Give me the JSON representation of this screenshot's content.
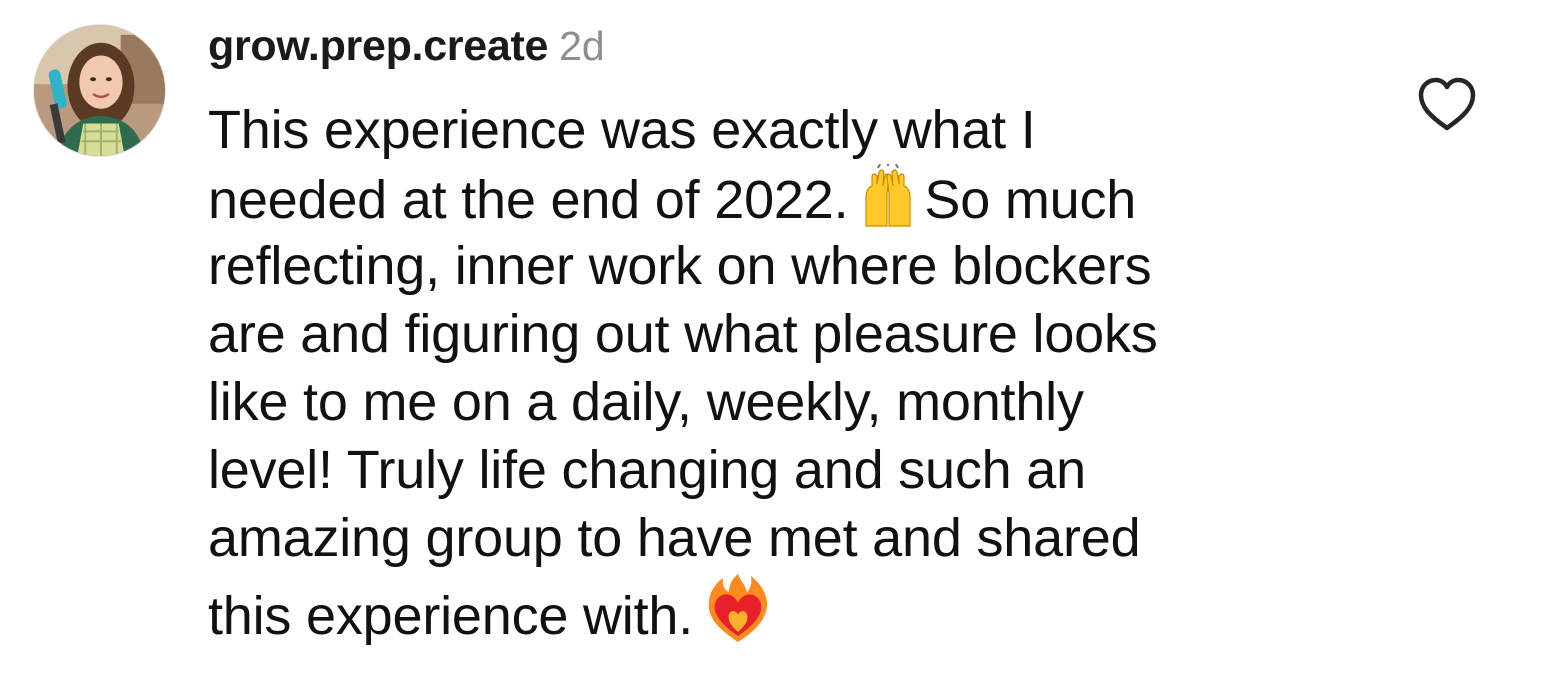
{
  "comment": {
    "username": "grow.prep.create",
    "timestamp": "2d",
    "lines": [
      "This experience was exactly what I",
      "needed at the end of 2022.",
      "So much",
      "reflecting, inner work on where blockers",
      "are and figuring out what pleasure looks",
      "like to me on a daily, weekly, monthly",
      "level! Truly life changing and such an",
      "amazing group to have met and shared",
      "this experience with."
    ],
    "emojis": {
      "first": "raising-hands-emoji",
      "second": "heart-on-fire-emoji"
    },
    "avatar_icon": "profile-photo",
    "like_icon": "heart-outline-icon"
  },
  "colors": {
    "text": "#111111",
    "timestamp": "#8e8e8e",
    "like_icon": "#262626"
  }
}
